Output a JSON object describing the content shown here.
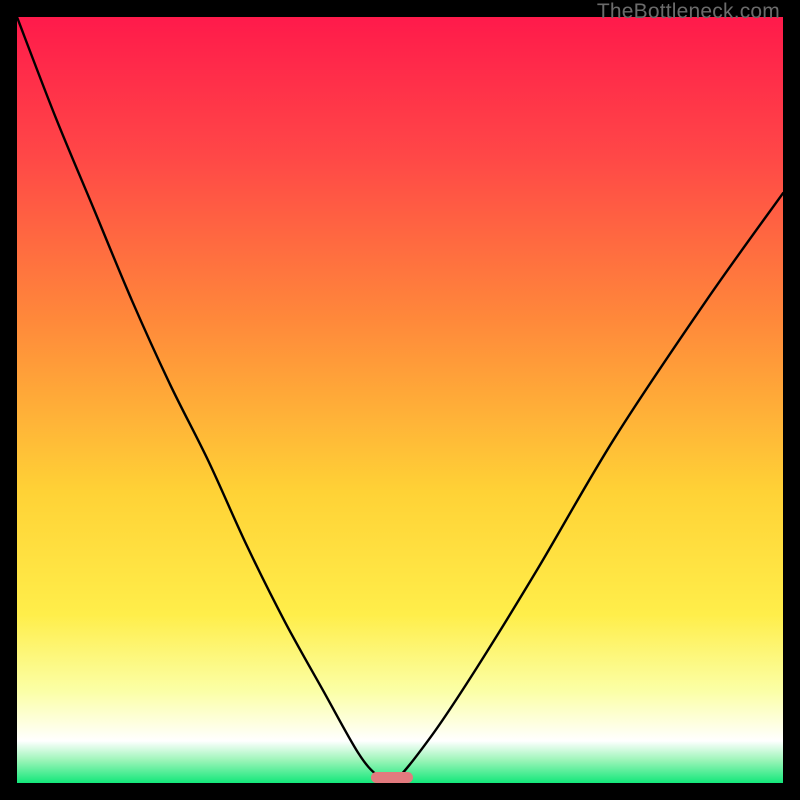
{
  "watermark": "TheBottleneck.com",
  "chart_data": {
    "type": "line",
    "title": "",
    "xlabel": "",
    "ylabel": "",
    "xlim": [
      0,
      100
    ],
    "ylim": [
      0,
      100
    ],
    "gradient_stops": [
      {
        "offset": 0.0,
        "color": "#ff1a4b"
      },
      {
        "offset": 0.18,
        "color": "#ff4747"
      },
      {
        "offset": 0.4,
        "color": "#ff8a3a"
      },
      {
        "offset": 0.62,
        "color": "#ffd236"
      },
      {
        "offset": 0.78,
        "color": "#ffee4a"
      },
      {
        "offset": 0.88,
        "color": "#fbffa6"
      },
      {
        "offset": 0.945,
        "color": "#ffffff"
      },
      {
        "offset": 0.97,
        "color": "#9df5b9"
      },
      {
        "offset": 1.0,
        "color": "#13e77a"
      }
    ],
    "series": [
      {
        "name": "bottleneck-curve",
        "x": [
          0,
          5,
          10,
          15,
          20,
          25,
          30,
          35,
          40,
          44.5,
          47,
          49,
          54,
          60,
          68,
          78,
          90,
          100
        ],
        "values": [
          100,
          87,
          75,
          63,
          52,
          42,
          31,
          21,
          12,
          4,
          1,
          0,
          6,
          15,
          28,
          45,
          63,
          77
        ]
      }
    ],
    "marker": {
      "x_center_pct": 49,
      "width_pct": 5.5,
      "color": "#e27a7e"
    }
  }
}
